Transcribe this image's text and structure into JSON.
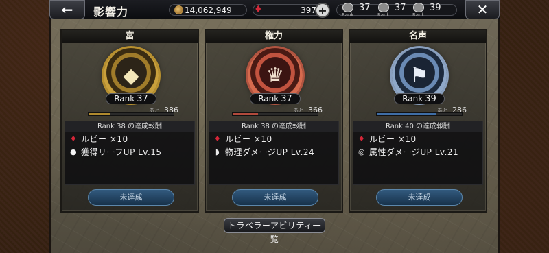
{
  "header": {
    "title": "影響力",
    "back_icon": "←",
    "close_icon": "✕",
    "leaf_count": "14,062,949",
    "ruby_count": "397",
    "plus_icon": "+",
    "ranks": [
      {
        "value": "37",
        "caption": "Rank"
      },
      {
        "value": "37",
        "caption": "Rank"
      },
      {
        "value": "39",
        "caption": "Rank"
      }
    ]
  },
  "cards": [
    {
      "title": "富",
      "rank_label": "Rank",
      "rank": "37",
      "remain_prefix": "あと",
      "remain": "386",
      "progress": 0.26,
      "progress_color": "#b08a2e",
      "reward_title": "Rank 38 の達成報酬",
      "reward1_label": "ルビー ×10",
      "reward2_label": "獲得リーフUP Lv.15",
      "status": "未達成",
      "emblem_glyph": "◆",
      "emblem_icon": "diamond-crest-icon"
    },
    {
      "title": "権力",
      "rank_label": "Rank",
      "rank": "37",
      "remain_prefix": "あと",
      "remain": "366",
      "progress": 0.3,
      "progress_color": "#b24a3c",
      "reward_title": "Rank 38 の達成報酬",
      "reward1_label": "ルビー ×10",
      "reward2_label": "物理ダメージUP Lv.24",
      "status": "未達成",
      "emblem_glyph": "♛",
      "emblem_icon": "crown-crest-icon"
    },
    {
      "title": "名声",
      "rank_label": "Rank",
      "rank": "39",
      "remain_prefix": "あと",
      "remain": "286",
      "progress": 0.7,
      "progress_color": "#3f6ea6",
      "reward_title": "Rank 40 の達成報酬",
      "reward1_label": "ルビー ×10",
      "reward2_label": "属性ダメージUP Lv.21",
      "status": "未達成",
      "emblem_glyph": "⚑",
      "emblem_icon": "banner-crest-icon"
    }
  ],
  "footer": {
    "list_button": "トラベラーアビリティ一覧"
  }
}
